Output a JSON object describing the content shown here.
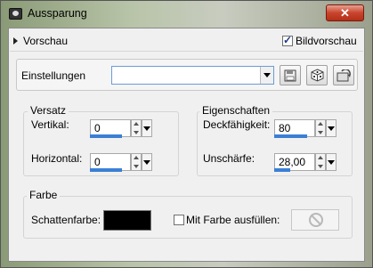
{
  "window": {
    "title": "Aussparung",
    "close_label": "✕"
  },
  "preview": {
    "label": "Vorschau",
    "bildvorschau_label": "Bildvorschau",
    "bildvorschau_checked": true
  },
  "settings": {
    "label": "Einstellungen",
    "value": ""
  },
  "versatz": {
    "title": "Versatz",
    "vertikal": {
      "label": "Vertikal:",
      "value": "0"
    },
    "horizontal": {
      "label": "Horizontal:",
      "value": "0"
    }
  },
  "eigenschaften": {
    "title": "Eigenschaften",
    "deckfaehigkeit": {
      "label": "Deckfähigkeit:",
      "value": "80"
    },
    "unschaerfe": {
      "label": "Unschärfe:",
      "value": "28,00"
    }
  },
  "farbe": {
    "title": "Farbe",
    "schattenfarbe_label": "Schattenfarbe:",
    "schattenfarbe_color": "#000000",
    "fill_label": "Mit Farbe ausfüllen:",
    "fill_checked": false
  },
  "icons": {
    "save": "save-icon",
    "dice": "dice-icon",
    "reset": "reset-icon",
    "nosign": "no-sign-icon"
  }
}
